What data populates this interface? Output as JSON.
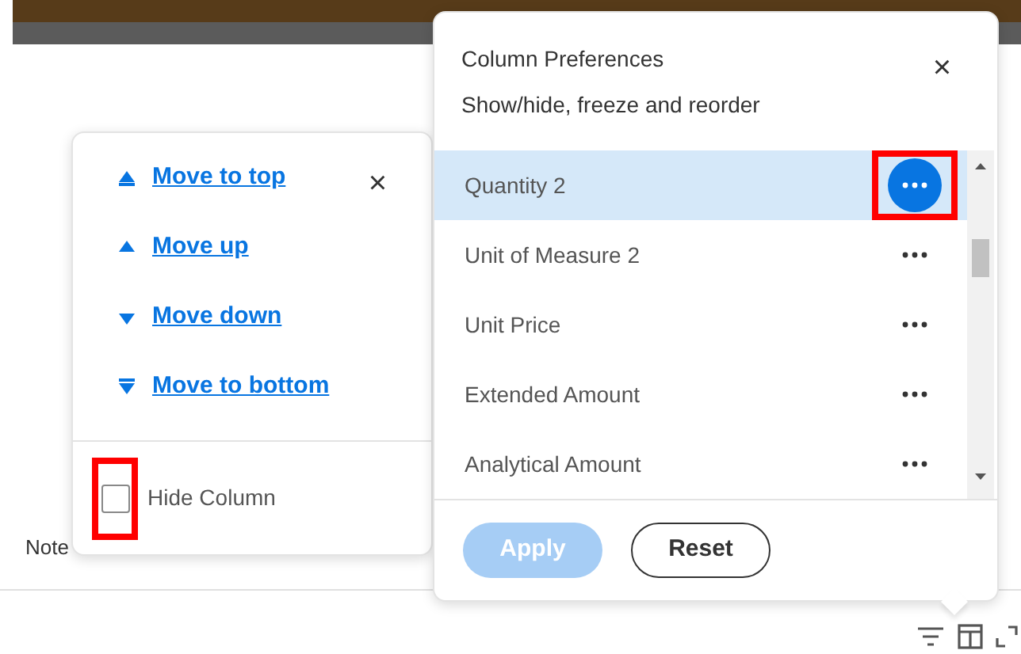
{
  "background": {
    "note_label": "Note"
  },
  "move_menu": {
    "actions": [
      {
        "label": "Move to top",
        "kind": "top"
      },
      {
        "label": "Move up",
        "kind": "up"
      },
      {
        "label": "Move down",
        "kind": "down"
      },
      {
        "label": "Move to bottom",
        "kind": "bottom"
      }
    ],
    "close": "×",
    "hide_column": {
      "label": "Hide Column",
      "checked": false,
      "highlighted": true
    }
  },
  "column_preferences": {
    "title": "Column Preferences",
    "subtitle": "Show/hide, freeze and reorder",
    "close": "×",
    "columns": [
      {
        "name": "Quantity 2",
        "selected": true
      },
      {
        "name": "Unit of Measure 2",
        "selected": false
      },
      {
        "name": "Unit Price",
        "selected": false
      },
      {
        "name": "Extended Amount",
        "selected": false
      },
      {
        "name": "Analytical Amount",
        "selected": false
      }
    ],
    "apply": {
      "label": "Apply",
      "disabled": true
    },
    "reset": {
      "label": "Reset"
    }
  }
}
